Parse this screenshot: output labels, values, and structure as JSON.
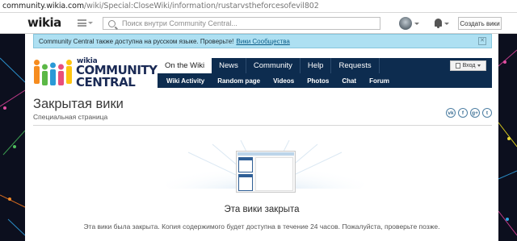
{
  "browser": {
    "url_host": "community.wikia.com",
    "url_path": "/wiki/Special:CloseWiki/information/rustarvstheforcesofevil802"
  },
  "global_nav": {
    "logo": "wikia",
    "search_placeholder": "Поиск внутри Community Central...",
    "create_wiki_label": "Создать вики"
  },
  "notice": {
    "text": "Community Central также доступна на русском языке. Проверьте!",
    "link": "Вики Сообщества",
    "close": "✕"
  },
  "wiki_logo": {
    "small": "wikia",
    "line1": "COMMUNITY",
    "line2": "CENTRAL",
    "colors": [
      "#f68c1f",
      "#5bb846",
      "#2b9ad6",
      "#e94e7a",
      "#fec40f"
    ]
  },
  "wiki_nav": {
    "tabs": [
      "On the Wiki",
      "News",
      "Community",
      "Help",
      "Requests"
    ],
    "subtabs": [
      "Wiki Activity",
      "Random page",
      "Videos",
      "Photos",
      "Chat",
      "Forum"
    ],
    "login_label": "Вход"
  },
  "page": {
    "title": "Закрытая вики",
    "subtitle": "Специальная страница",
    "socials": [
      "vk",
      "f",
      "g+",
      "t"
    ],
    "closed_heading": "Эта вики закрыта",
    "closed_text": "Эта вики была закрыта. Копия содержимого будет доступна в течение 24 часов. Пожалуйста, проверьте позже."
  },
  "colors": {
    "nav_bg": "#0d2c4f",
    "notice_bg": "#aee0f2",
    "page_bg": "#0c0f1e"
  }
}
